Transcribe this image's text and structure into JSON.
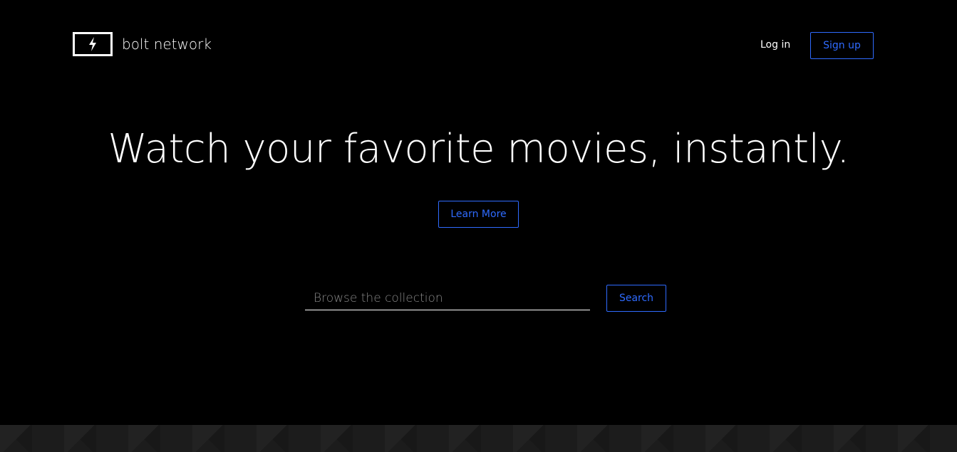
{
  "brand": {
    "name": "bolt network",
    "logo_icon": "lightning-bolt-icon"
  },
  "nav": {
    "login_label": "Log in",
    "signup_label": "Sign up"
  },
  "hero": {
    "headline": "Watch your favorite movies, instantly.",
    "cta_label": "Learn More"
  },
  "search": {
    "placeholder": "Browse the collection",
    "value": "",
    "button_label": "Search"
  },
  "colors": {
    "background": "#000000",
    "accent": "#2f6bff",
    "text": "#ffffff",
    "footer_strip": "#1c1c1c"
  }
}
